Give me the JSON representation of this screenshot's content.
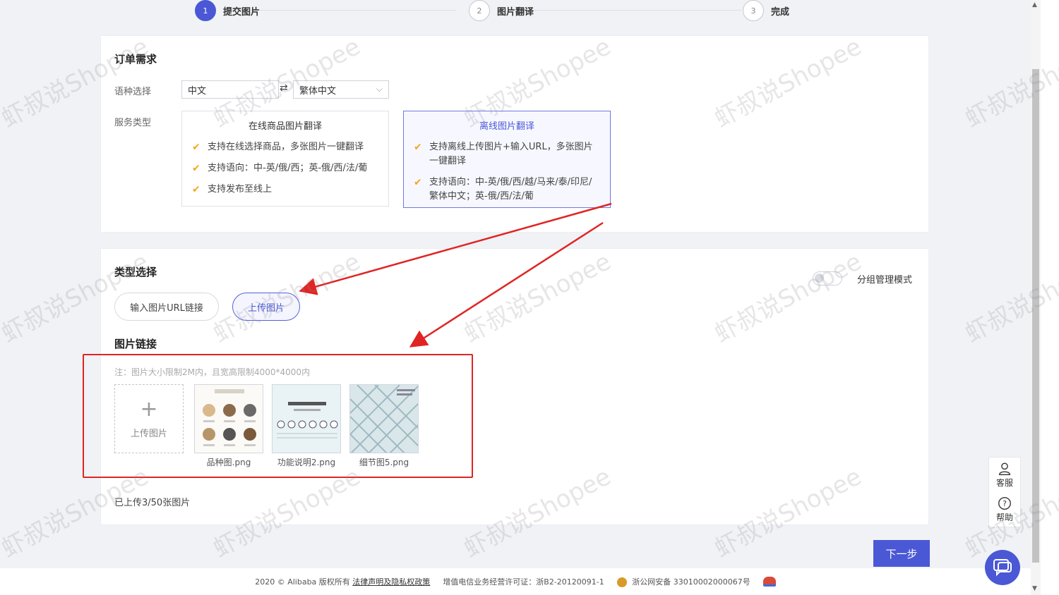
{
  "stepper": {
    "steps": [
      {
        "number": "1",
        "label": "提交图片"
      },
      {
        "number": "2",
        "label": "图片翻译"
      },
      {
        "number": "3",
        "label": "完成"
      }
    ]
  },
  "order": {
    "title": "订单需求",
    "language_label": "语种选择",
    "source_lang": "中文",
    "target_lang": "繁体中文",
    "service_label": "服务类型",
    "services": [
      {
        "title": "在线商品图片翻译",
        "features": [
          "支持在线选择商品，多张图片一键翻译",
          "支持语向：中-英/俄/西；英-俄/西/法/葡",
          "支持发布至线上"
        ]
      },
      {
        "title": "离线图片翻译",
        "features": [
          "支持离线上传图片+输入URL，多张图片一键翻译",
          "支持语向：中-英/俄/西/越/马来/泰/印尼/繁体中文；英-俄/西/法/葡"
        ]
      }
    ]
  },
  "type_select": {
    "title": "类型选择",
    "options": [
      "输入图片URL链接",
      "上传图片"
    ],
    "group_mode_label": "分组管理模式"
  },
  "image_links": {
    "title": "图片链接",
    "note": "注：图片大小限制2M内，且宽高限制4000*4000内",
    "upload_label": "上传图片",
    "files": [
      "品种图.png",
      "功能说明2.png",
      "细节图5.png"
    ],
    "count_text": "已上传3/50张图片"
  },
  "next_button": "下一步",
  "footer": {
    "copyright": "2020 © Alibaba 版权所有",
    "legal_link": "法律声明及隐私权政策",
    "license": "增值电信业务经营许可证：浙B2-20120091-1",
    "police": "浙公网安备 33010002000067号"
  },
  "side_tools": {
    "service": "客服",
    "help": "帮助"
  },
  "watermark": "虾叔说Shopee",
  "colors": {
    "primary": "#4a58d6",
    "annotation_red": "#e02424",
    "check": "#f2a81c"
  }
}
